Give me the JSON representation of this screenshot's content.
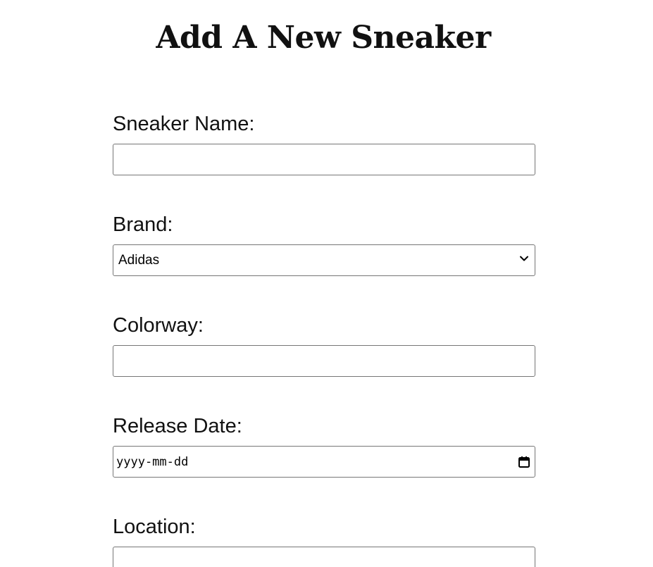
{
  "page": {
    "title": "Add A New Sneaker"
  },
  "form": {
    "name_label": "Sneaker Name:",
    "name_value": "",
    "brand_label": "Brand:",
    "brand_selected": "Adidas",
    "colorway_label": "Colorway:",
    "colorway_value": "",
    "release_label": "Release Date:",
    "release_placeholder": "yyyy-mm-dd",
    "location_label": "Location:",
    "location_value": ""
  },
  "icons": {
    "brand_dropdown": "chevron-down-icon",
    "release_date_picker": "calendar-icon"
  }
}
